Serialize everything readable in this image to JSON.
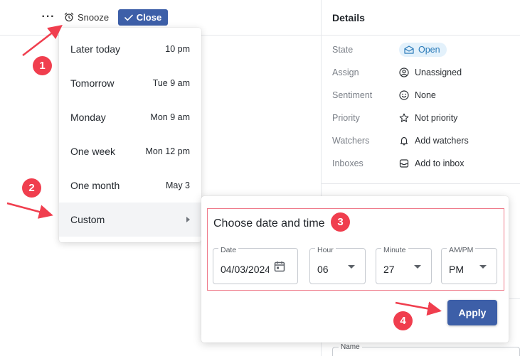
{
  "toolbar": {
    "more_label": "···",
    "snooze_label": "Snooze",
    "close_label": "Close"
  },
  "details": {
    "title": "Details",
    "rows": [
      {
        "label": "State",
        "value": "Open",
        "icon": "envelope-open-icon"
      },
      {
        "label": "Assign",
        "value": "Unassigned",
        "icon": "user-circle-icon"
      },
      {
        "label": "Sentiment",
        "value": "None",
        "icon": "smiley-icon"
      },
      {
        "label": "Priority",
        "value": "Not priority",
        "icon": "star-icon"
      },
      {
        "label": "Watchers",
        "value": "Add watchers",
        "icon": "bell-icon"
      },
      {
        "label": "Inboxes",
        "value": "Add to inbox",
        "icon": "inbox-icon"
      }
    ],
    "name_label": "Name"
  },
  "snooze_menu": {
    "items": [
      {
        "label": "Later today",
        "time": "10 pm"
      },
      {
        "label": "Tomorrow",
        "time": "Tue 9 am"
      },
      {
        "label": "Monday",
        "time": "Mon 9 am"
      },
      {
        "label": "One week",
        "time": "Mon 12 pm"
      },
      {
        "label": "One month",
        "time": "May 3"
      },
      {
        "label": "Custom",
        "time": ""
      }
    ]
  },
  "custom_picker": {
    "title": "Choose date and time",
    "date": {
      "label": "Date",
      "value": "04/03/2024"
    },
    "hour": {
      "label": "Hour",
      "value": "06"
    },
    "minute": {
      "label": "Minute",
      "value": "27"
    },
    "ampm": {
      "label": "AM/PM",
      "value": "PM"
    },
    "apply_label": "Apply"
  },
  "annotations": {
    "step1": "1",
    "step2": "2",
    "step3": "3",
    "step4": "4"
  },
  "colors": {
    "primary": "#3d5fa8",
    "annotation": "#f03e4e",
    "state_pill_bg": "#e3f1fb",
    "state_pill_text": "#2b7bb9"
  }
}
